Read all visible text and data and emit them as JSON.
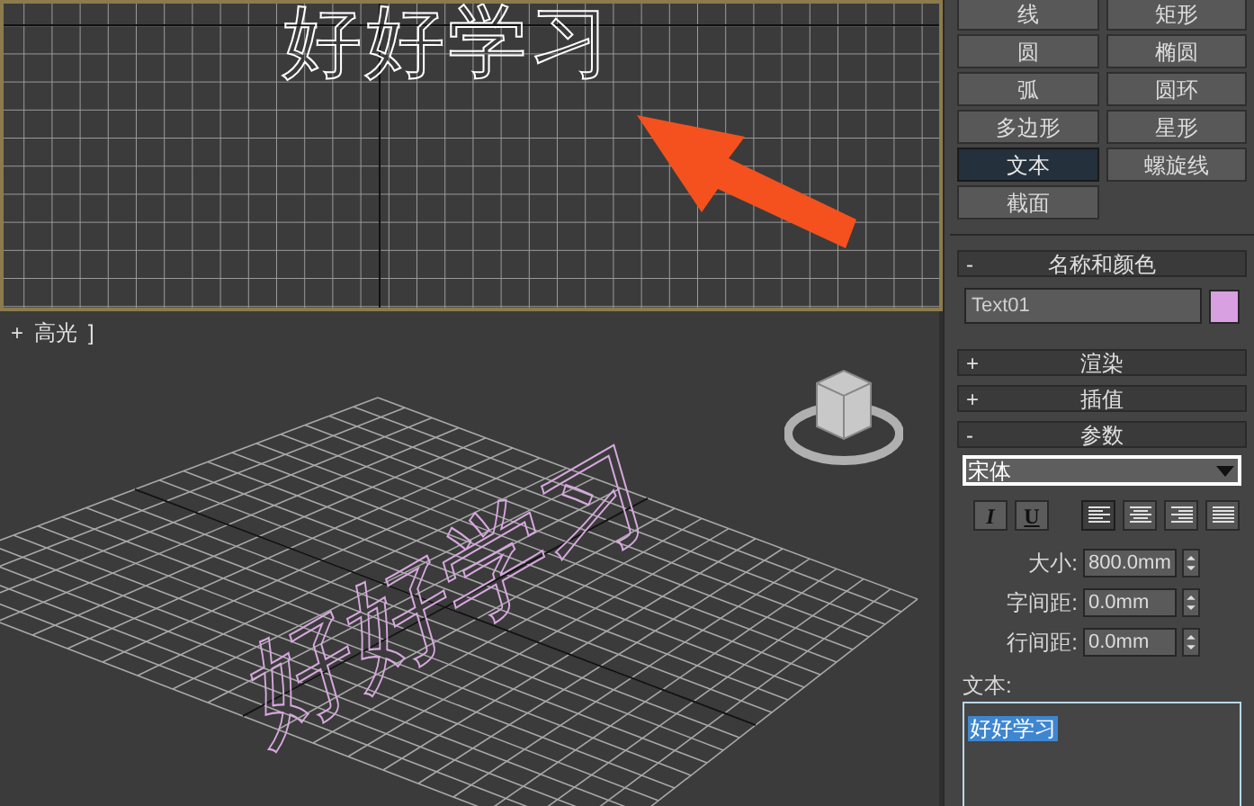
{
  "viewport_top": {
    "text_object": "好好学习"
  },
  "viewport_perspective": {
    "menu_plus": "+",
    "label": "高光",
    "label_bracket": "]",
    "text_object": "好好学习"
  },
  "object_types": [
    {
      "label": "线",
      "selected": false
    },
    {
      "label": "矩形",
      "selected": false
    },
    {
      "label": "圆",
      "selected": false
    },
    {
      "label": "椭圆",
      "selected": false
    },
    {
      "label": "弧",
      "selected": false
    },
    {
      "label": "圆环",
      "selected": false
    },
    {
      "label": "多边形",
      "selected": false
    },
    {
      "label": "星形",
      "selected": false
    },
    {
      "label": "文本",
      "selected": true
    },
    {
      "label": "螺旋线",
      "selected": false
    },
    {
      "label": "截面",
      "selected": false
    }
  ],
  "name_color": {
    "sign": "-",
    "title": "名称和颜色",
    "expanded": true,
    "name": "Text01",
    "color": "#d8a0e0"
  },
  "collapsed_rollouts": [
    {
      "sign": "+",
      "title": "渲染"
    },
    {
      "sign": "+",
      "title": "插值"
    }
  ],
  "parameters": {
    "sign": "-",
    "title": "参数",
    "expanded": true,
    "font": "宋体",
    "style_buttons": [
      {
        "kind": "italic",
        "label": "I",
        "on": false
      },
      {
        "kind": "underline",
        "label": "U",
        "on": false
      }
    ],
    "alignment": [
      {
        "kind": "left",
        "selected": true
      },
      {
        "kind": "center",
        "selected": false
      },
      {
        "kind": "right",
        "selected": false
      },
      {
        "kind": "justify",
        "selected": false
      }
    ],
    "spinners": [
      {
        "label": "大小:",
        "value": "800.0mm"
      },
      {
        "label": "字间距:",
        "value": "0.0mm"
      },
      {
        "label": "行间距:",
        "value": "0.0mm"
      }
    ],
    "text_label": "文本:",
    "text_value": "好好学习"
  }
}
